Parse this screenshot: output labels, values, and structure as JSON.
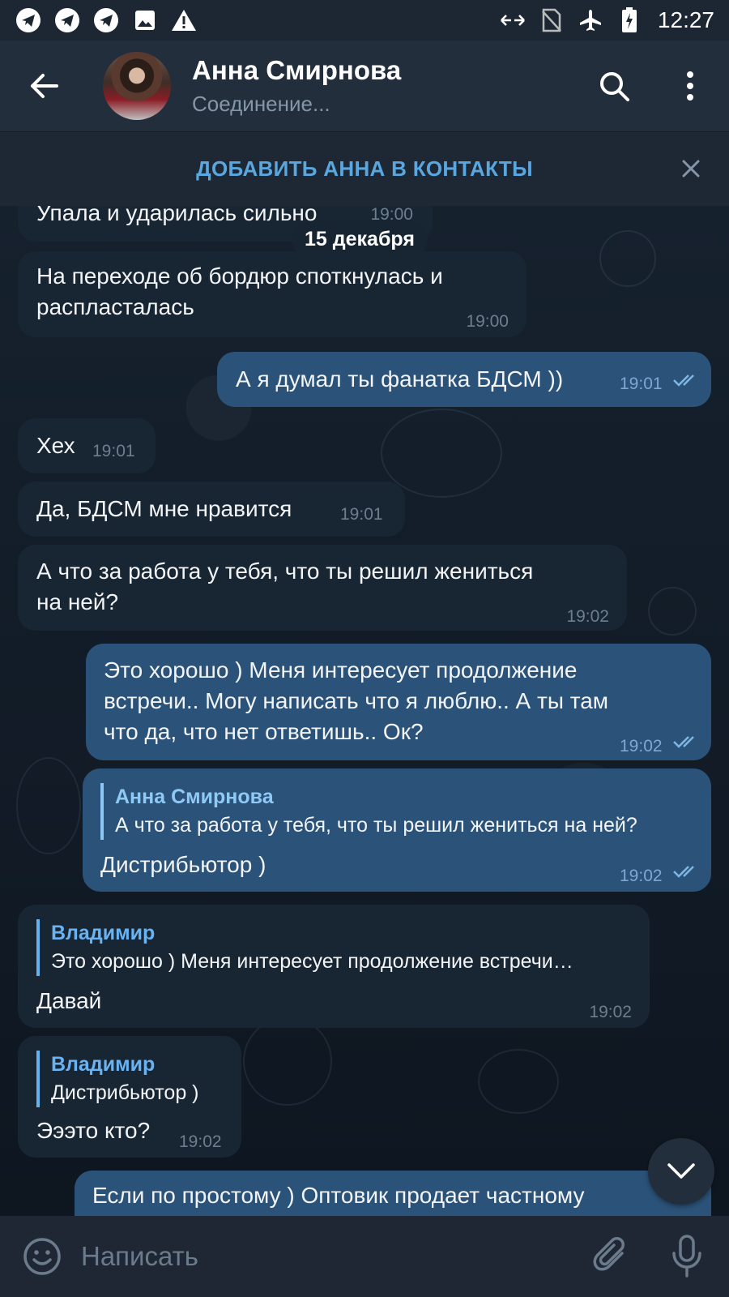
{
  "status_bar": {
    "time": "12:27",
    "left_icons": [
      "telegram-icon",
      "telegram-icon",
      "telegram-icon",
      "image-icon",
      "warning-icon"
    ],
    "right_icons": [
      "data-arrows-icon",
      "no-sim-icon",
      "airplane-icon",
      "battery-icon"
    ]
  },
  "header": {
    "title": "Анна Смирнова",
    "status": "Соединение..."
  },
  "add_contact": {
    "label": "ДОБАВИТЬ АННА В КОНТАКТЫ"
  },
  "date_separator": "15 декабря",
  "messages": [
    {
      "dir": "in",
      "text": "Упала и ударилась сильно",
      "time": "19:00"
    },
    {
      "dir": "in",
      "text_lines": [
        "На переходе об бордюр споткнулась и",
        "распласталась"
      ],
      "time": "19:00"
    },
    {
      "dir": "out",
      "text": "А я думал ты фанатка БДСМ ))",
      "time": "19:01",
      "read": true
    },
    {
      "dir": "in",
      "text": "Хех",
      "time": "19:01"
    },
    {
      "dir": "in",
      "text": "Да, БДСМ мне нравится",
      "time": "19:01"
    },
    {
      "dir": "in",
      "text_lines": [
        "А что за работа у тебя, что ты решил жениться",
        "на ней?"
      ],
      "time": "19:02"
    },
    {
      "dir": "out",
      "text_lines": [
        "Это хорошо ) Меня интересует продолжение",
        "встречи.. Могу написать что я люблю.. А ты там",
        "что да, что нет ответишь.. Ок?"
      ],
      "time": "19:02",
      "read": true
    },
    {
      "dir": "out",
      "reply_name": "Анна Смирнова",
      "reply_text": "А что за работа у тебя, что ты решил жениться на ней?",
      "text": "Дистрибьютор )",
      "time": "19:02",
      "read": true
    },
    {
      "dir": "in",
      "reply_name": "Владимир",
      "reply_text": "Это хорошо ) Меня интересует продолжение встречи…",
      "text": "Давай",
      "time": "19:02"
    },
    {
      "dir": "in",
      "reply_name": "Владимир",
      "reply_text": "Дистрибьютор )",
      "text": "Эээто кто?",
      "time": "19:02"
    },
    {
      "dir": "out",
      "text": "Если по простому ) Оптовик продает частному"
    }
  ],
  "input": {
    "placeholder": "Написать"
  }
}
